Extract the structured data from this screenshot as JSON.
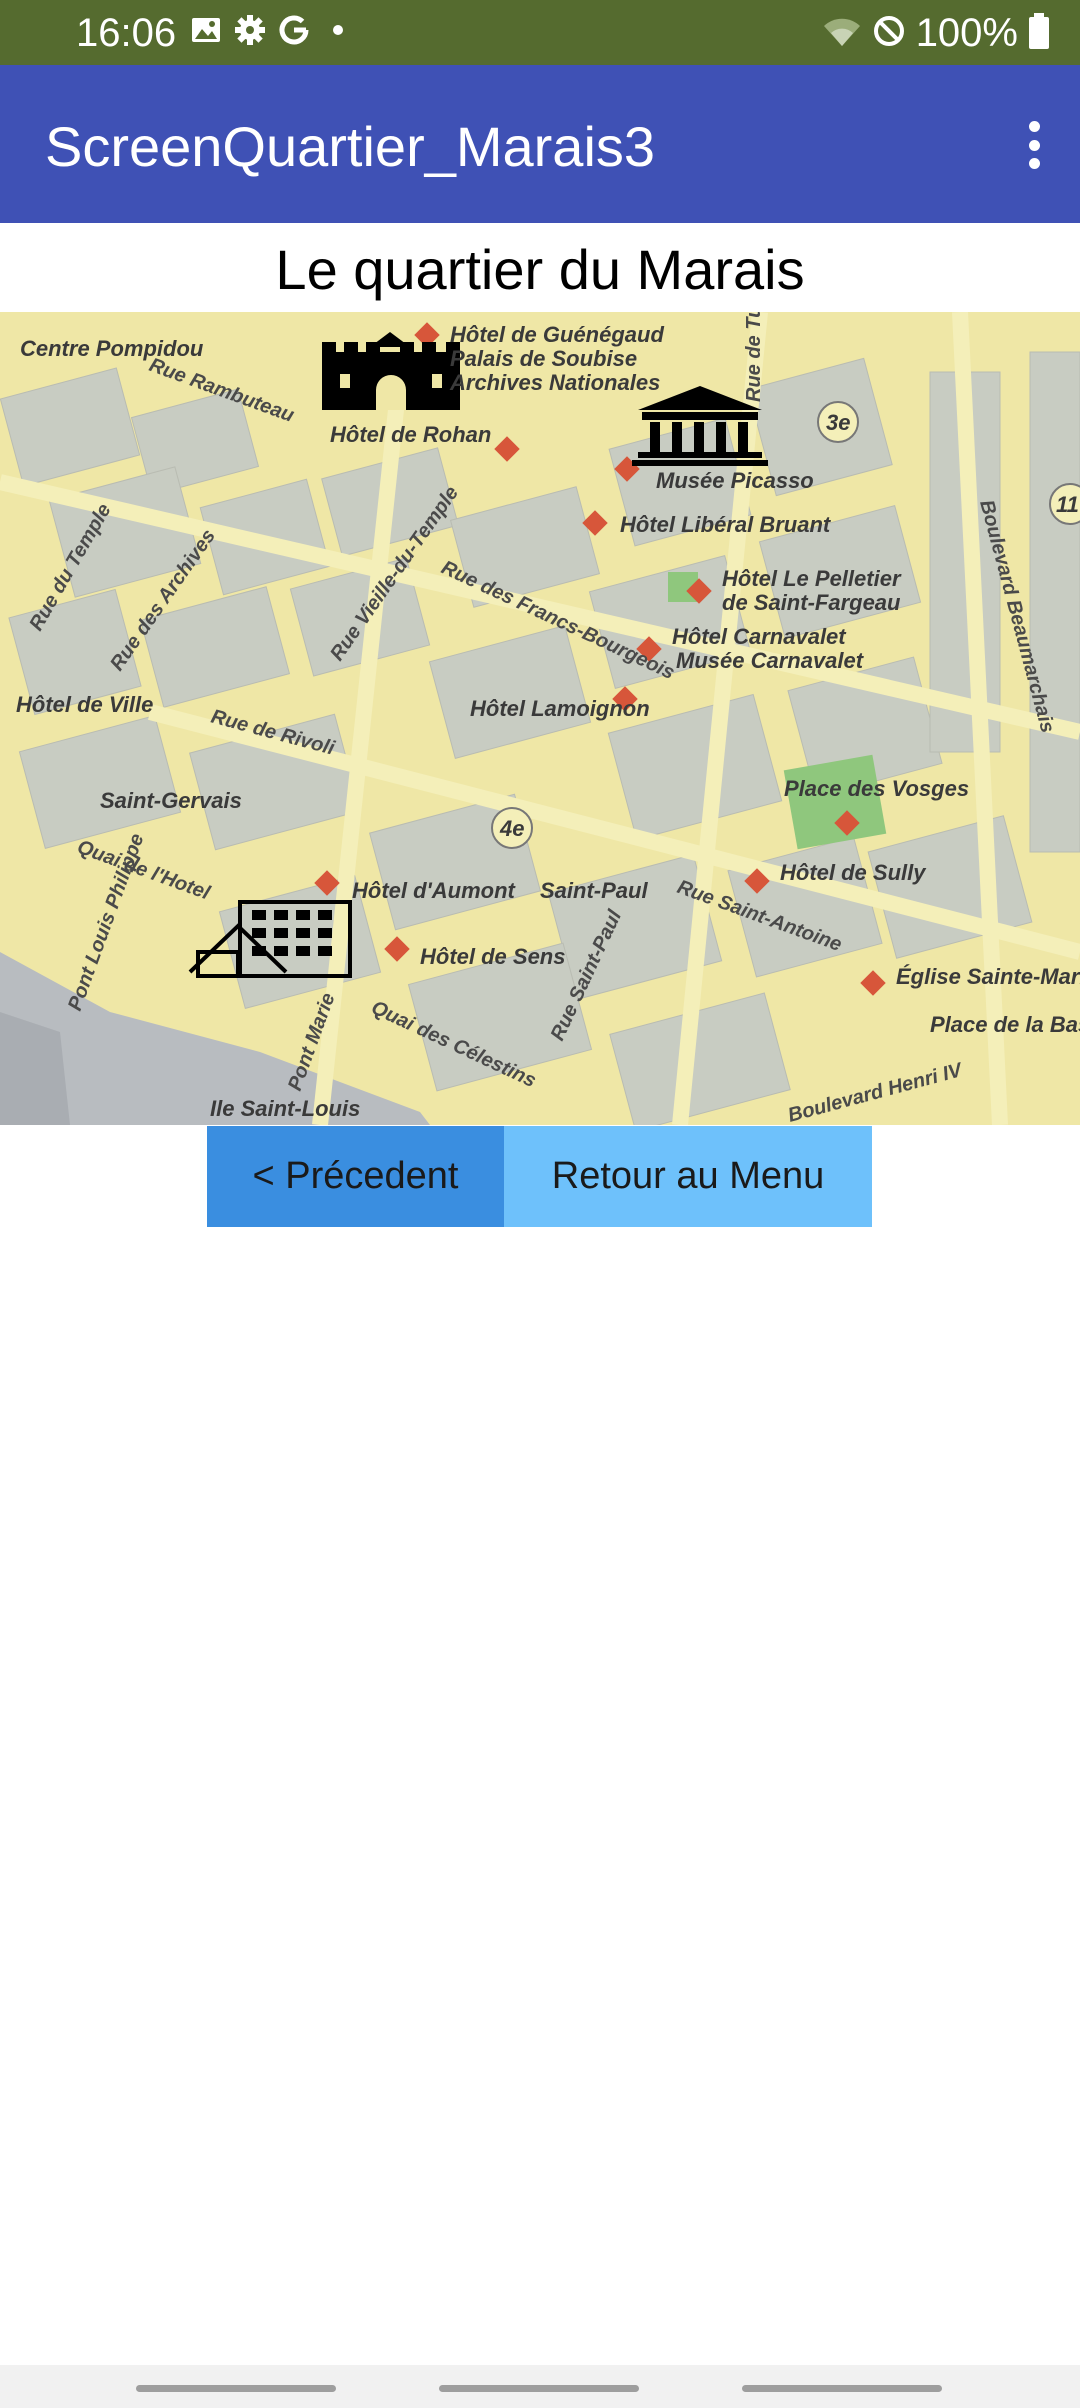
{
  "status_bar": {
    "time": "16:06",
    "battery_text": "100%",
    "icons": [
      "image-icon",
      "gear-icon",
      "google-icon",
      "dot-icon",
      "wifi-icon",
      "do-not-disturb-icon",
      "battery-icon"
    ]
  },
  "app_bar": {
    "title": "ScreenQuartier_Marais3",
    "menu_icon": "more-vert-icon"
  },
  "page": {
    "title": "Le quartier du Marais"
  },
  "map": {
    "places": [
      {
        "name": "Hôtel de Guénégaud"
      },
      {
        "name": "Palais de Soubise"
      },
      {
        "name": "Archives Nationales"
      },
      {
        "name": "Hôtel de Rohan"
      },
      {
        "name": "Musée Picasso"
      },
      {
        "name": "Hôtel Libéral Bruant"
      },
      {
        "name": "Hôtel Le Pelletier"
      },
      {
        "name": "de Saint-Fargeau"
      },
      {
        "name": "Hôtel Carnavalet"
      },
      {
        "name": "Musée Carnavalet"
      },
      {
        "name": "Hôtel Lamoignon"
      },
      {
        "name": "Place des Vosges"
      },
      {
        "name": "Hôtel de Sully"
      },
      {
        "name": "Église Sainte-Marie"
      },
      {
        "name": "Place de la Bastille"
      },
      {
        "name": "Hôtel de Sens"
      },
      {
        "name": "Hôtel d'Aumont"
      },
      {
        "name": "Saint-Paul"
      },
      {
        "name": "Saint-Gervais"
      },
      {
        "name": "Hôtel de Ville"
      },
      {
        "name": "Centre Pompidou"
      },
      {
        "name": "Ile Saint-Louis"
      }
    ],
    "streets": [
      "Rue Rambuteau",
      "Rue du Temple",
      "Rue des Archives",
      "Rue Vieille-du-Temple",
      "Rue des Francs-Bourgeois",
      "Rue de Rivoli",
      "Quai de l'Hotel",
      "Pont Louis Philippe",
      "Pont Marie",
      "Quai des Célestins",
      "Rue Saint-Paul",
      "Rue Saint-Antoine",
      "Boulevard Beaumarchais",
      "Rue de Turenne",
      "Boulevard Henri IV"
    ],
    "arrondissements": [
      "3e",
      "4e",
      "11"
    ]
  },
  "buttons": {
    "previous": "< Précedent",
    "menu": "Retour au Menu"
  }
}
